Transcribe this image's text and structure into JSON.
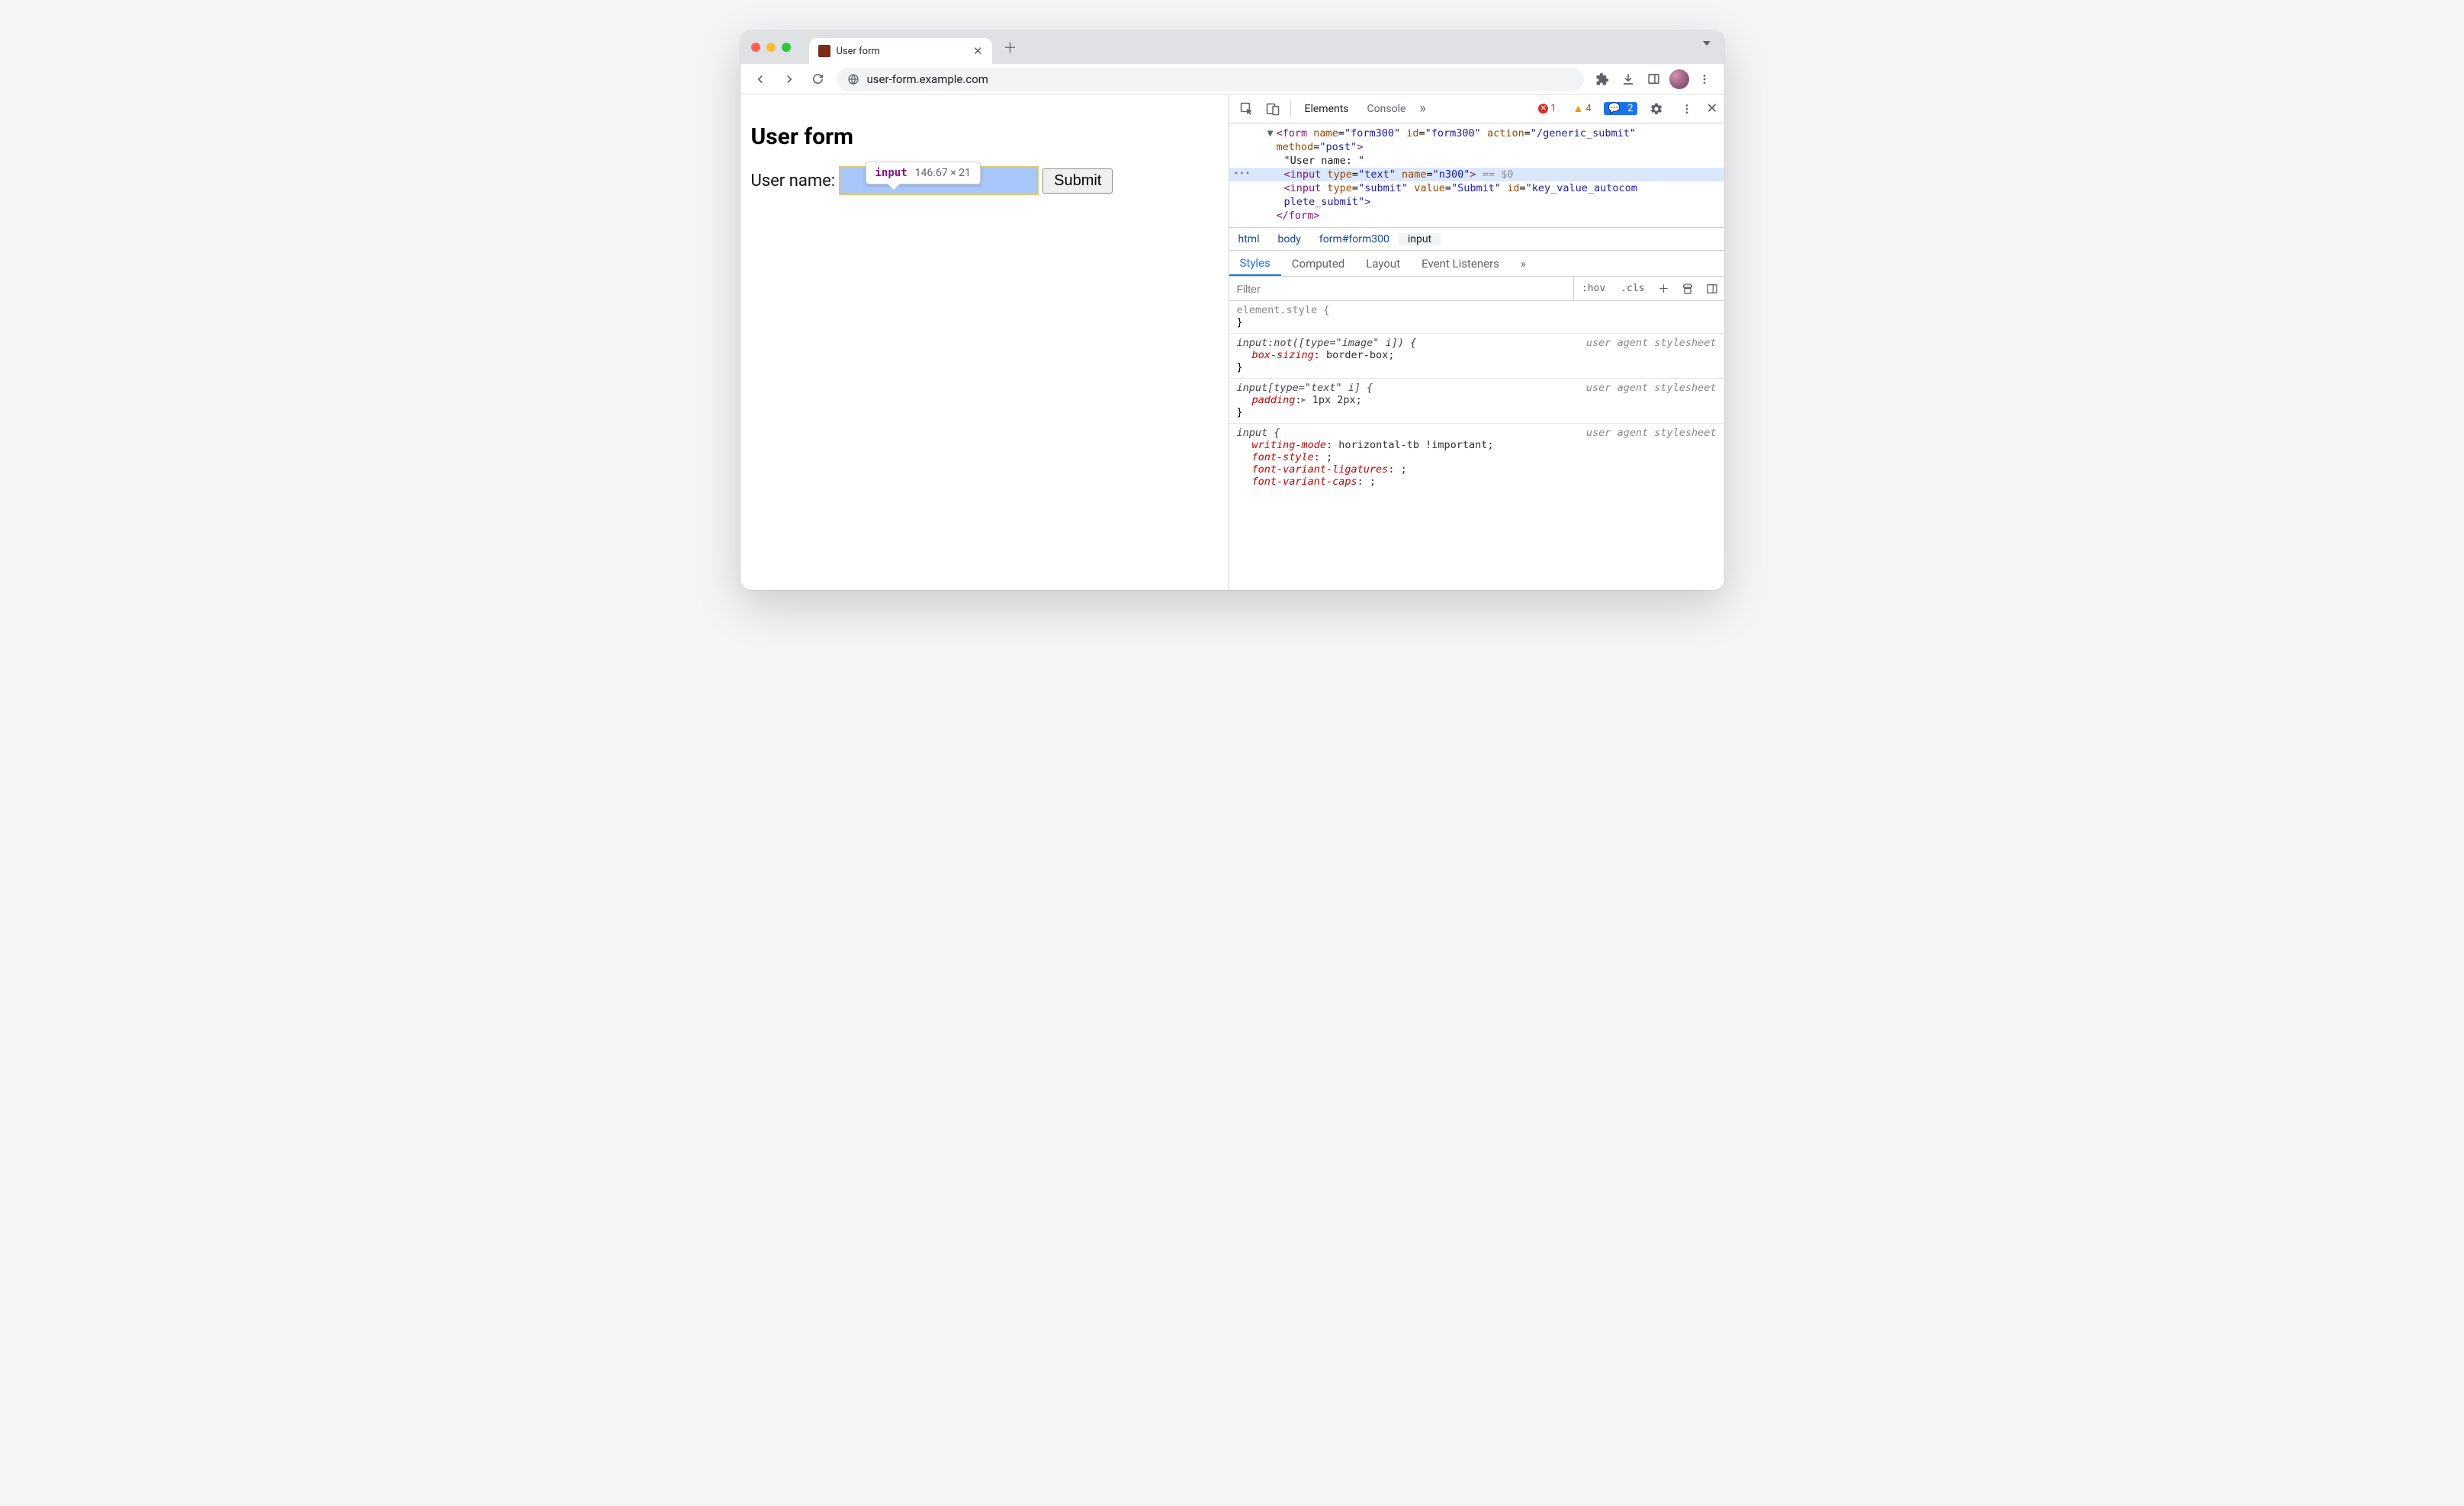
{
  "browser": {
    "tab_title": "User form",
    "url": "user-form.example.com"
  },
  "page": {
    "heading": "User form",
    "label": "User name:",
    "submit_label": "Submit"
  },
  "tooltip": {
    "tag": "input",
    "dimensions": "146.67 × 21"
  },
  "devtools": {
    "tabs": {
      "elements": "Elements",
      "console": "Console"
    },
    "counts": {
      "errors": "1",
      "warnings": "4",
      "messages": "2"
    },
    "dom": {
      "form_open_1": "<form ",
      "form_name_a": "name",
      "form_name_v": "\"form300\"",
      "form_id_a": "id",
      "form_id_v": "\"form300\"",
      "form_action_a": "action",
      "form_action_v": "\"/generic_submit\"",
      "form_method_a": "method",
      "form_method_v": "\"post\"",
      "form_open_2": ">",
      "text_node": "\"User name: \"",
      "input1_open": "<input ",
      "input1_type_a": "type",
      "input1_type_v": "\"text\"",
      "input1_name_a": "name",
      "input1_name_v": "\"n300\"",
      "input1_close": ">",
      "eq0": " == $0",
      "input2_open": "<input ",
      "input2_type_a": "type",
      "input2_type_v": "\"submit\"",
      "input2_value_a": "value",
      "input2_value_v": "\"Submit\"",
      "input2_id_a": "id",
      "input2_id_v": "\"key_value_autocom",
      "input2_line2": "plete_submit\">",
      "form_close": "</form>"
    },
    "breadcrumb": {
      "html": "html",
      "body": "body",
      "form": "form#form300",
      "input": "input"
    },
    "styles_tabs": {
      "styles": "Styles",
      "computed": "Computed",
      "layout": "Layout",
      "listeners": "Event Listeners"
    },
    "filter_placeholder": "Filter",
    "filter_chips": {
      "hov": ":hov",
      "cls": ".cls"
    },
    "rules": {
      "r0": {
        "selector": "element.style {",
        "close": "}"
      },
      "r1": {
        "selector": "input:not([type=\"image\" i]) {",
        "source": "user agent stylesheet",
        "p1n": "box-sizing",
        "p1v": ": border-box;",
        "close": "}"
      },
      "r2": {
        "selector": "input[type=\"text\" i] {",
        "source": "user agent stylesheet",
        "p1n": "padding",
        "p1v": " 1px 2px;",
        "close": "}"
      },
      "r3": {
        "selector": "input {",
        "source": "user agent stylesheet",
        "p1n": "writing-mode",
        "p1v": ": horizontal-tb !important;",
        "p2n": "font-style",
        "p2v": ": ;",
        "p3n": "font-variant-ligatures",
        "p3v": ": ;",
        "p4n": "font-variant-caps",
        "p4v": ": ;"
      }
    }
  }
}
